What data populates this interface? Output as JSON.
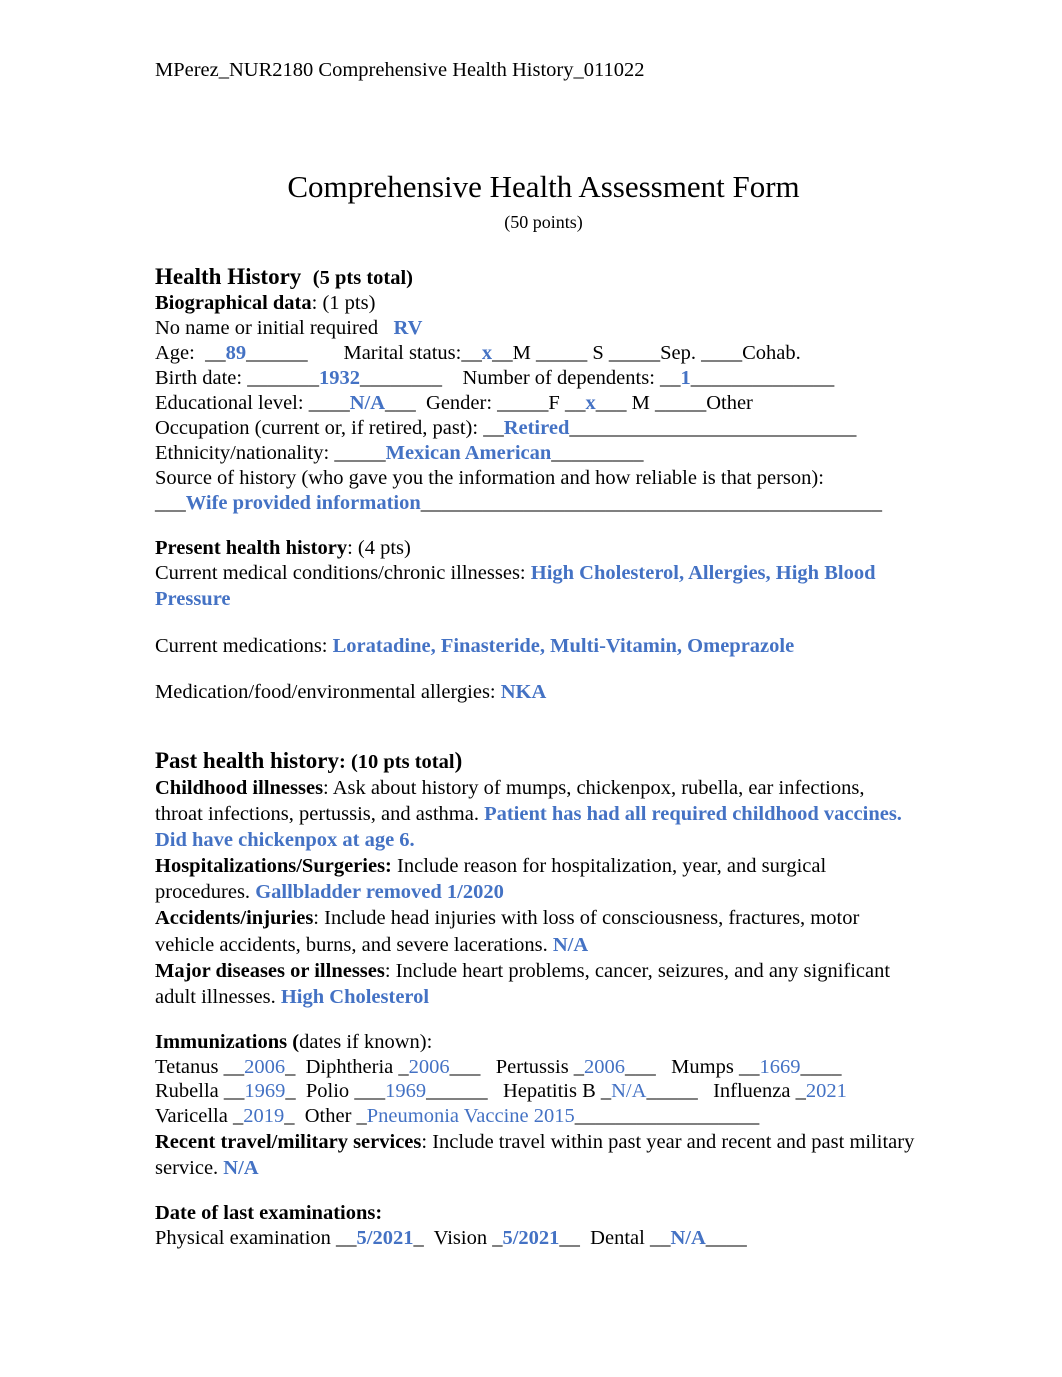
{
  "document": {
    "header": "MPerez_NUR2180 Comprehensive Health History_011022",
    "title": "Comprehensive Health Assessment Form",
    "points": "(50 points)"
  },
  "accent_color": "#4472C4",
  "health_history": {
    "heading_label": "Health History",
    "heading_points": "(5 pts total)",
    "biographical": {
      "label": "Biographical data",
      "points": ": (1 pts)",
      "name_line_label": "No name or initial required",
      "name_value": "RV",
      "age_label": "Age:",
      "age_blank_pre": "__",
      "age_value": "89",
      "age_blank_post": "______",
      "marital_label": "Marital status:",
      "marital_married_pre": "__",
      "marital_married_mark": "x",
      "marital_married_post": "__M",
      "marital_single": "_____ S",
      "marital_sep": "_____Sep.",
      "marital_cohab": "____Cohab.",
      "birth_label": "Birth date:",
      "birth_blank_pre": "_______",
      "birth_value": "1932",
      "birth_blank_post": "________",
      "dependents_label": "Number of dependents:",
      "dependents_blank_pre": "__",
      "dependents_value": "1",
      "dependents_blank_post": "______________",
      "education_label": "Educational level:",
      "education_blank_pre": "____",
      "education_value": "N/A",
      "education_blank_post": "___",
      "gender_label": "Gender:",
      "gender_female": "_____F",
      "gender_male_pre": "__",
      "gender_male_mark": "x",
      "gender_male_post": "___ M",
      "gender_other": "_____Other",
      "occupation_label": "Occupation (current or, if retired, past):",
      "occupation_blank_pre": "__",
      "occupation_value": "Retired",
      "occupation_blank_post": "____________________________",
      "ethnicity_label": "Ethnicity/nationality:",
      "ethnicity_blank_pre": "_____",
      "ethnicity_value": "Mexican American",
      "ethnicity_blank_post": "_________",
      "source_label": "Source of history (who gave you the information and how reliable is that person):",
      "source_blank_pre": "___",
      "source_value": "Wife provided information",
      "source_blank_post": "_____________________________________________"
    }
  },
  "present_health_history": {
    "label": "Present health history",
    "points": ": (4 pts)",
    "conditions_label": "Current medical conditions/chronic illnesses:",
    "conditions_value": "High Cholesterol, Allergies, High Blood Pressure",
    "medications_label": "Current medications:",
    "medications_value": "Loratadine, Finasteride, Multi-Vitamin, Omeprazole",
    "allergies_label": "Medication/food/environmental allergies:",
    "allergies_value": "NKA"
  },
  "past_health_history": {
    "heading_label": "Past health history",
    "heading_points": ": (10 pts total",
    "heading_paren": ")",
    "childhood_label": "Childhood illnesses",
    "childhood_prompt": ": Ask about history of mumps, chickenpox, rubella, ear infections, throat infections, pertussis, and asthma.",
    "childhood_value": "Patient has had all required childhood vaccines. Did have chickenpox at age 6.",
    "hospitalizations_label": "Hospitalizations/Surgeries:",
    "hospitalizations_prompt": "Include reason for hospitalization, year, and surgical procedures.",
    "hospitalizations_value": "Gallbladder removed 1/2020",
    "accidents_label": "Accidents/injuries",
    "accidents_prompt": ": Include head injuries with loss of consciousness, fractures, motor vehicle accidents, burns, and severe lacerations.",
    "accidents_value": "N/A",
    "major_label": "Major diseases or illnesses",
    "major_prompt": ": Include heart problems, cancer, seizures, and any significant adult illnesses.",
    "major_value": "High Cholesterol",
    "immunizations": {
      "label": "Immunizations (",
      "prompt": "dates if known):",
      "tetanus_label": "Tetanus",
      "tetanus_pre": "__",
      "tetanus_value": "2006",
      "tetanus_post": "_",
      "diphtheria_label": "Diphtheria",
      "diphtheria_pre": "_",
      "diphtheria_value": "2006",
      "diphtheria_post": "___",
      "pertussis_label": "Pertussis",
      "pertussis_pre": "_",
      "pertussis_value": "2006",
      "pertussis_post": "___",
      "mumps_label": "Mumps",
      "mumps_pre": "__",
      "mumps_value": "1669",
      "mumps_post": "____",
      "rubella_label": "Rubella",
      "rubella_pre": "__",
      "rubella_value": "1969",
      "rubella_post": "_",
      "polio_label": "Polio",
      "polio_pre": "___",
      "polio_value": "1969",
      "polio_post": "______",
      "hepatitis_label": "Hepatitis B",
      "hepatitis_pre": "_",
      "hepatitis_value": "N/A",
      "hepatitis_post": "_____",
      "influenza_label": "Influenza",
      "influenza_pre": "_",
      "influenza_value": "2021",
      "influenza_post": "",
      "varicella_label": "Varicella",
      "varicella_pre": "_",
      "varicella_value": "2019",
      "varicella_post": "_",
      "other_label": "Other",
      "other_pre": "_",
      "other_value": "Pneumonia Vaccine 2015",
      "other_post": "__________________"
    },
    "travel_label": "Recent travel/military services",
    "travel_prompt": ": Include travel within past year and recent and past military service.",
    "travel_value": "N/A"
  },
  "last_examinations": {
    "heading": "Date of last examinations:",
    "physical_label": "Physical examination",
    "physical_pre": "__",
    "physical_value": "5/2021",
    "physical_post": "_",
    "vision_label": "Vision",
    "vision_pre": "_",
    "vision_value": "5/2021",
    "vision_post": "__",
    "dental_label": "Dental",
    "dental_pre": "__",
    "dental_value": "N/A",
    "dental_post": "____"
  }
}
